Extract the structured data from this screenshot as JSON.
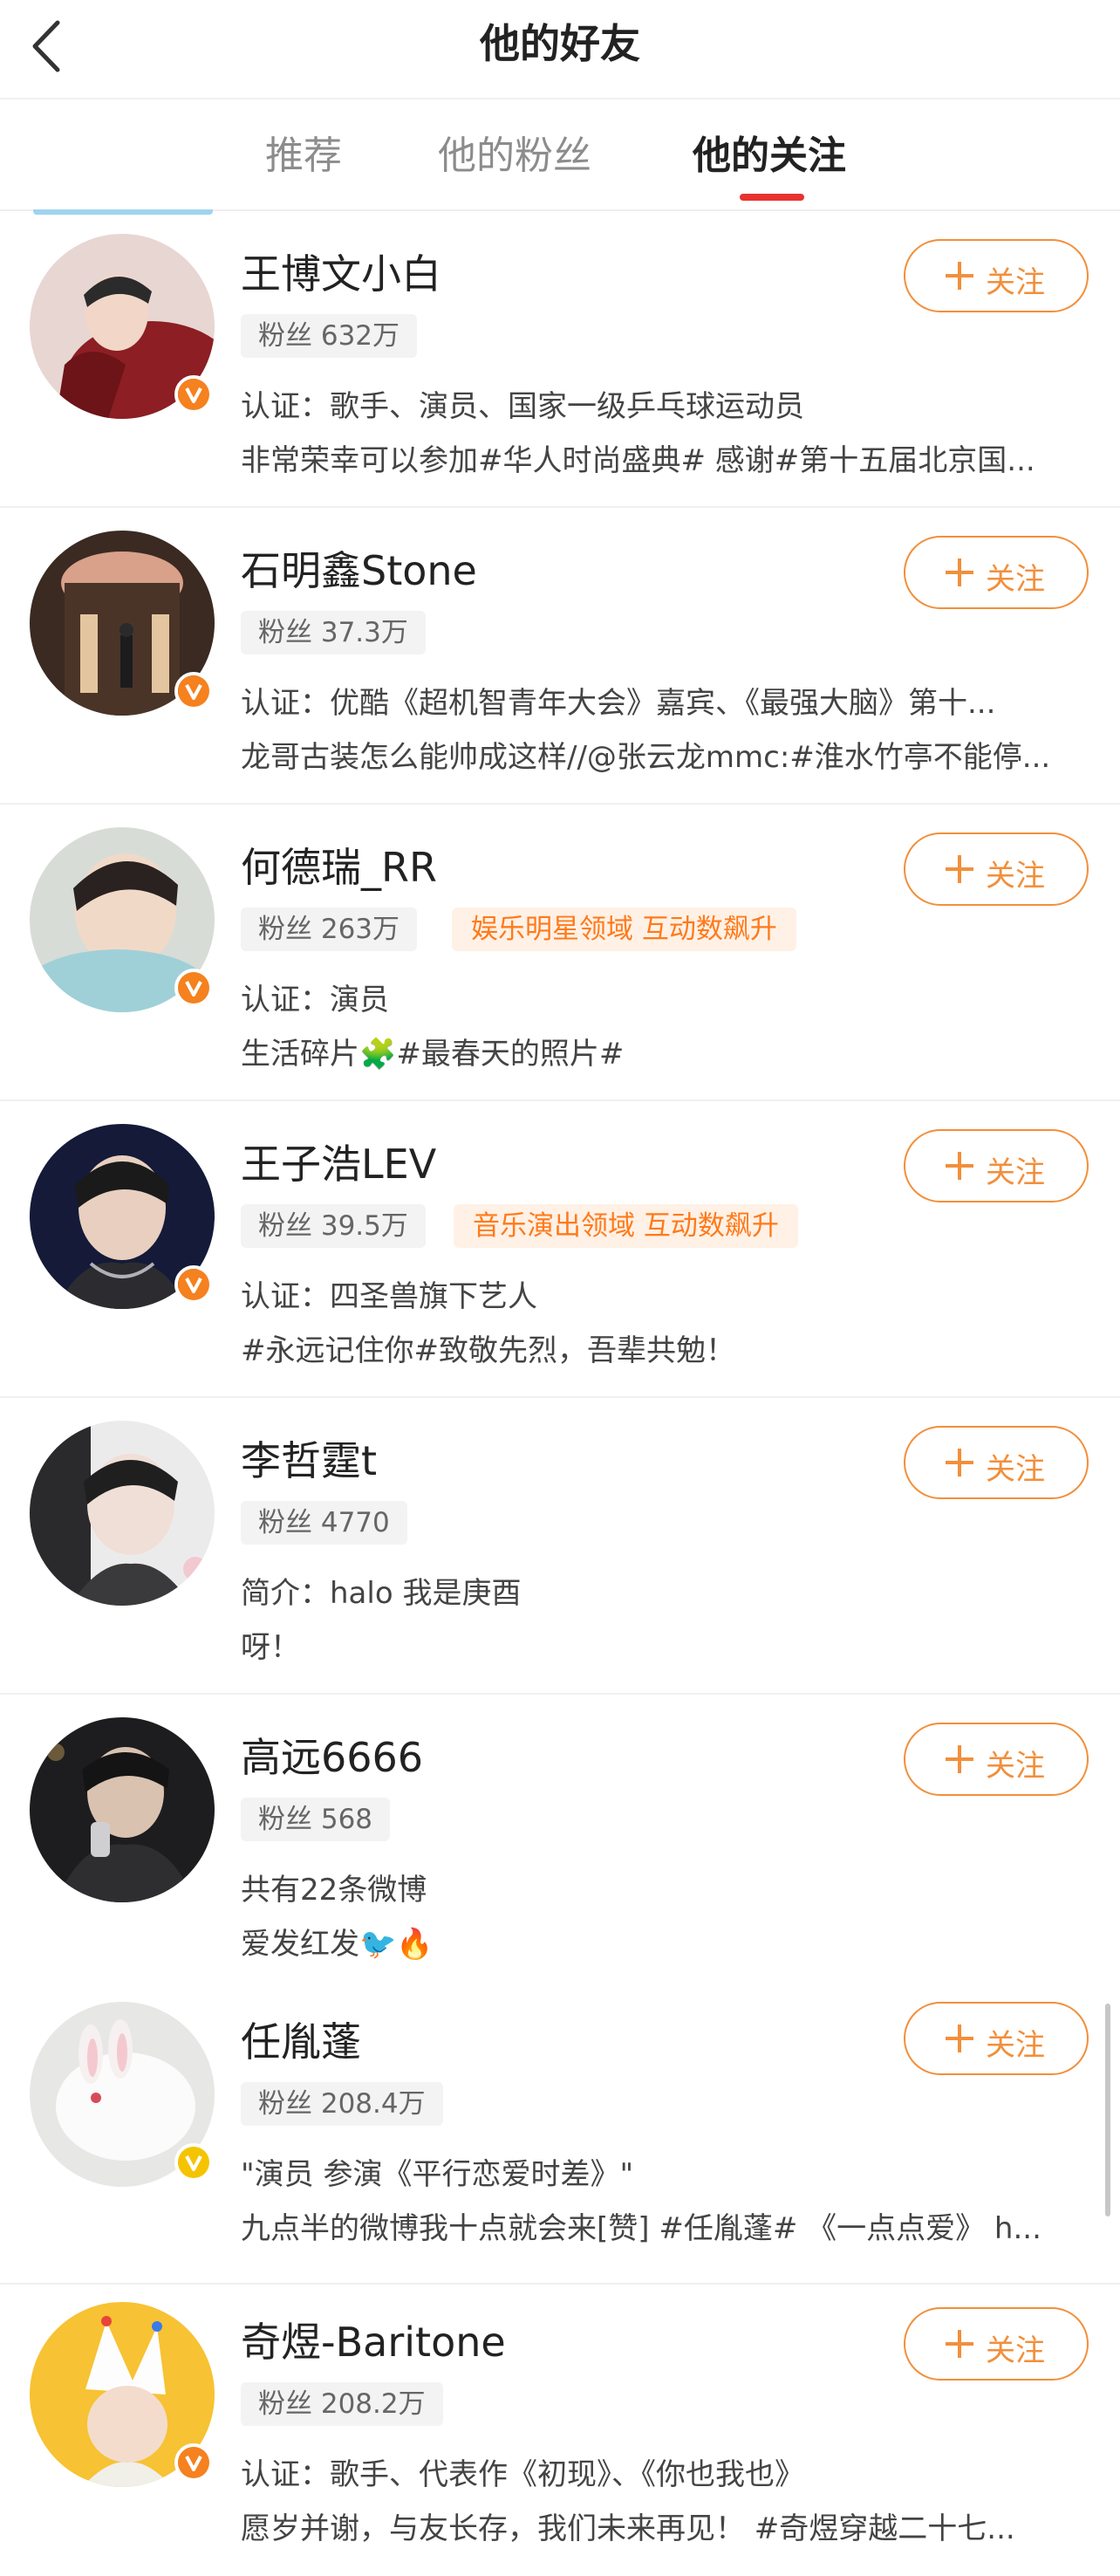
{
  "header": {
    "title": "他的好友"
  },
  "tabs": [
    {
      "label": "推荐",
      "active": false
    },
    {
      "label": "他的粉丝",
      "active": false
    },
    {
      "label": "他的关注",
      "active": true
    }
  ],
  "colors": {
    "accent": "#f28f3b",
    "tab_indicator": "#e8322f",
    "verified_orange": "#f5811f",
    "verified_yellow": "#f5c400"
  },
  "users": [
    {
      "name": "王博文小白",
      "fans": "粉丝 632万",
      "tag": "",
      "line1": "认证：歌手、演员、国家一级乒乓球运动员",
      "line2": "非常荣幸可以参加#华人时尚盛典# 感谢#第十五届北京国...",
      "follow": "关注",
      "verified": "orange"
    },
    {
      "name": "石明鑫Stone",
      "fans": "粉丝 37.3万",
      "tag": "",
      "line1": "认证：优酷《超机智青年大会》嘉宾、《最强大脑》第十...",
      "line2": "龙哥古装怎么能帅成这样//@张云龙mmc:#淮水竹亭不能停...",
      "follow": "关注",
      "verified": "orange"
    },
    {
      "name": "何德瑞_RR",
      "fans": "粉丝 263万",
      "tag": "娱乐明星领域 互动数飙升",
      "line1": "认证：演员",
      "line2": "生活碎片🧩#最春天的照片#",
      "follow": "关注",
      "verified": "orange"
    },
    {
      "name": "王子浩LEV",
      "fans": "粉丝 39.5万",
      "tag": "音乐演出领域 互动数飙升",
      "line1": "认证：四圣兽旗下艺人",
      "line2": "#永远记住你#致敬先烈，吾辈共勉！",
      "follow": "关注",
      "verified": "orange"
    },
    {
      "name": "李哲霆t",
      "fans": "粉丝 4770",
      "tag": "",
      "line1": "简介：halo 我是庚酉",
      "line2": "呀！",
      "follow": "关注",
      "verified": ""
    },
    {
      "name": "高远6666",
      "fans": "粉丝 568",
      "tag": "",
      "line1": "共有22条微博",
      "line2": "爱发红发🐦🔥",
      "follow": "关注",
      "verified": ""
    },
    {
      "name": "任胤蓬",
      "fans": "粉丝 208.4万",
      "tag": "",
      "line1": "\"演员 参演《平行恋爱时差》\"",
      "line2": "九点半的微博我十点就会来[赞] #任胤蓬# 《一点点爱》 h...",
      "follow": "关注",
      "verified": "yellow"
    },
    {
      "name": "奇煜-Baritone",
      "fans": "粉丝 208.2万",
      "tag": "",
      "line1": "认证：歌手、代表作《初现》、《你也我也》",
      "line2": "愿岁并谢，与友长存，我们未来再见！ #奇煜穿越二十七...",
      "follow": "关注",
      "verified": "orange"
    }
  ]
}
